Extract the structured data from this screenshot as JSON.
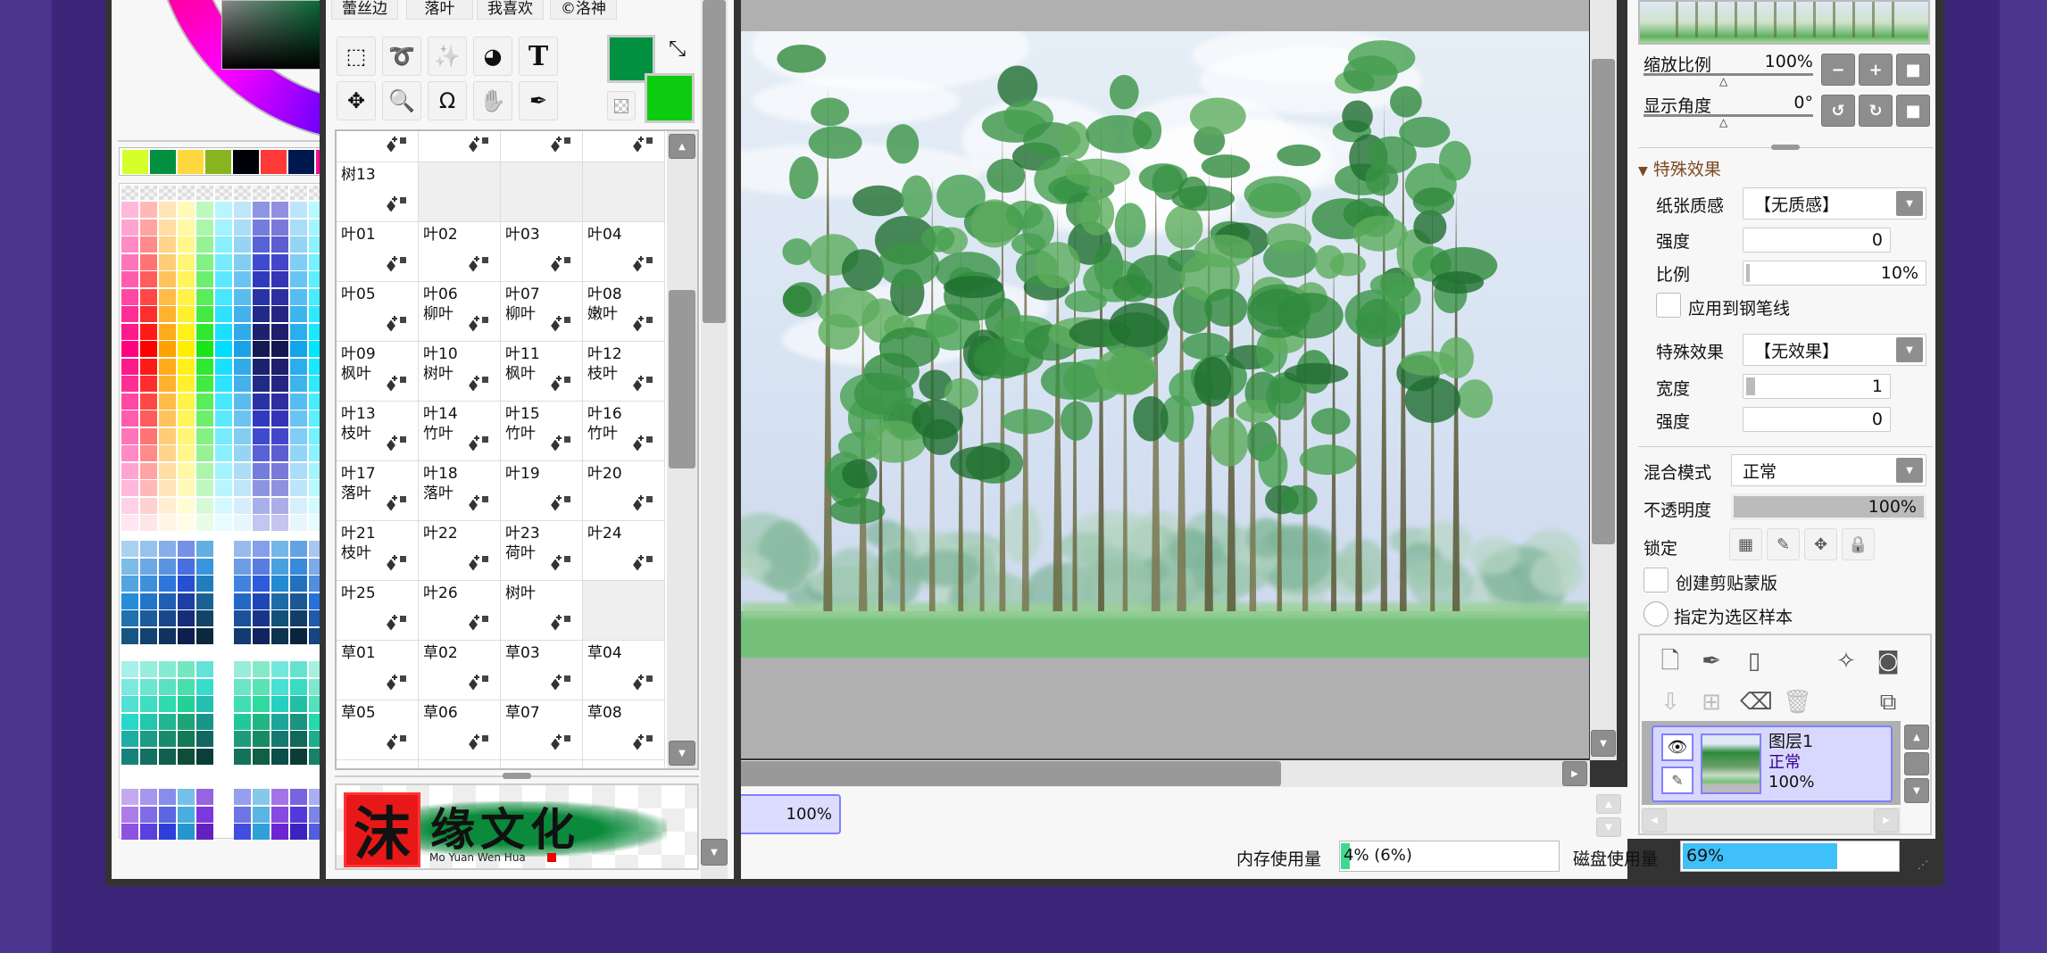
{
  "color_panel": {
    "swatches": [
      "#d4ff2a",
      "#009040",
      "#ffd840",
      "#88b420",
      "#000008",
      "#ff3838",
      "#001850",
      "#ff0890"
    ],
    "hue_square_color": "#006830"
  },
  "tool_panel": {
    "tabs": [
      "蕾丝边",
      "落叶",
      "我喜欢",
      "©洛神"
    ],
    "tools": [
      {
        "name": "rect-select-icon",
        "glyph": "⬚"
      },
      {
        "name": "lasso-icon",
        "glyph": "➰"
      },
      {
        "name": "magic-wand-icon",
        "glyph": "✨"
      },
      {
        "name": "fill-shape-icon",
        "glyph": "◕"
      },
      {
        "name": "text-tool-icon",
        "glyph": "T"
      },
      {
        "name": "move-icon",
        "glyph": "✥"
      },
      {
        "name": "zoom-icon",
        "glyph": "🔍"
      },
      {
        "name": "rotate-icon",
        "glyph": "Ω"
      },
      {
        "name": "hand-icon",
        "glyph": "✋"
      },
      {
        "name": "eyedropper-icon",
        "glyph": "✒"
      }
    ],
    "foreground_color": "#009040",
    "background_color": "#0ccc10",
    "swap_glyph": "⤡",
    "brush_rows": [
      [
        {
          "l1": "",
          "l2": ""
        },
        {
          "l1": "",
          "l2": ""
        },
        {
          "l1": "",
          "l2": ""
        },
        {
          "l1": "",
          "l2": ""
        }
      ],
      [
        {
          "l1": "树13",
          "l2": ""
        },
        {
          "empty": true
        },
        {
          "empty": true
        },
        {
          "empty": true
        }
      ],
      [
        {
          "l1": "叶01",
          "l2": ""
        },
        {
          "l1": "叶02",
          "l2": ""
        },
        {
          "l1": "叶03",
          "l2": ""
        },
        {
          "l1": "叶04",
          "l2": ""
        }
      ],
      [
        {
          "l1": "叶05",
          "l2": ""
        },
        {
          "l1": "叶06",
          "l2": "柳叶"
        },
        {
          "l1": "叶07",
          "l2": "柳叶"
        },
        {
          "l1": "叶08",
          "l2": "嫩叶"
        }
      ],
      [
        {
          "l1": "叶09",
          "l2": "枫叶"
        },
        {
          "l1": "叶10",
          "l2": "树叶"
        },
        {
          "l1": "叶11",
          "l2": "枫叶"
        },
        {
          "l1": "叶12",
          "l2": "枝叶"
        }
      ],
      [
        {
          "l1": "叶13",
          "l2": "枝叶"
        },
        {
          "l1": "叶14",
          "l2": "竹叶"
        },
        {
          "l1": "叶15",
          "l2": "竹叶"
        },
        {
          "l1": "叶16",
          "l2": "竹叶"
        }
      ],
      [
        {
          "l1": "叶17",
          "l2": "落叶"
        },
        {
          "l1": "叶18",
          "l2": "落叶"
        },
        {
          "l1": "叶19",
          "l2": ""
        },
        {
          "l1": "叶20",
          "l2": ""
        }
      ],
      [
        {
          "l1": "叶21",
          "l2": "枝叶"
        },
        {
          "l1": "叶22",
          "l2": ""
        },
        {
          "l1": "叶23",
          "l2": "荷叶"
        },
        {
          "l1": "叶24",
          "l2": ""
        }
      ],
      [
        {
          "l1": "叶25",
          "l2": ""
        },
        {
          "l1": "叶26",
          "l2": ""
        },
        {
          "l1": "树叶",
          "l2": ""
        },
        {
          "empty": true
        }
      ],
      [
        {
          "l1": "草01",
          "l2": ""
        },
        {
          "l1": "草02",
          "l2": ""
        },
        {
          "l1": "草03",
          "l2": ""
        },
        {
          "l1": "草04",
          "l2": ""
        }
      ],
      [
        {
          "l1": "草05",
          "l2": ""
        },
        {
          "l1": "草06",
          "l2": ""
        },
        {
          "l1": "草07",
          "l2": ""
        },
        {
          "l1": "草08",
          "l2": ""
        }
      ]
    ],
    "logo": {
      "seal": "沫",
      "text": "缘文化",
      "romanized": "Mo Yuan Wen Hua"
    }
  },
  "canvas": {
    "zoom_display": "100%"
  },
  "status": {
    "memory_label": "内存使用量",
    "memory_value": "4% (6%)",
    "memory_percent": 4,
    "disk_label": "磁盘使用量",
    "disk_value": "69%",
    "disk_percent": 69
  },
  "navigator": {
    "zoom_label": "缩放比例",
    "zoom_value": "100%",
    "angle_label": "显示角度",
    "angle_value": "0°",
    "zoom_buttons": [
      "−",
      "+",
      "■"
    ],
    "angle_buttons": [
      "↺",
      "↻",
      "■"
    ]
  },
  "effects": {
    "section_title": "特殊效果",
    "paper_label": "纸张质感",
    "paper_value": "【无质感】",
    "strength_label": "强度",
    "strength_value": "0",
    "scale_label": "比例",
    "scale_value": "10%",
    "apply_pen_label": "应用到钢笔线",
    "effect_label": "特殊效果",
    "effect_value": "【无效果】",
    "width_label": "宽度",
    "width_value": "1",
    "strength2_label": "强度",
    "strength2_value": "0"
  },
  "layer_props": {
    "blend_label": "混合模式",
    "blend_value": "正常",
    "opacity_label": "不透明度",
    "opacity_value": "100%",
    "lock_label": "锁定",
    "clip_label": "创建剪贴蒙版",
    "sample_label": "指定为选区样本"
  },
  "layers": [
    {
      "name": "图层1",
      "mode": "正常",
      "opacity": "100%"
    }
  ]
}
